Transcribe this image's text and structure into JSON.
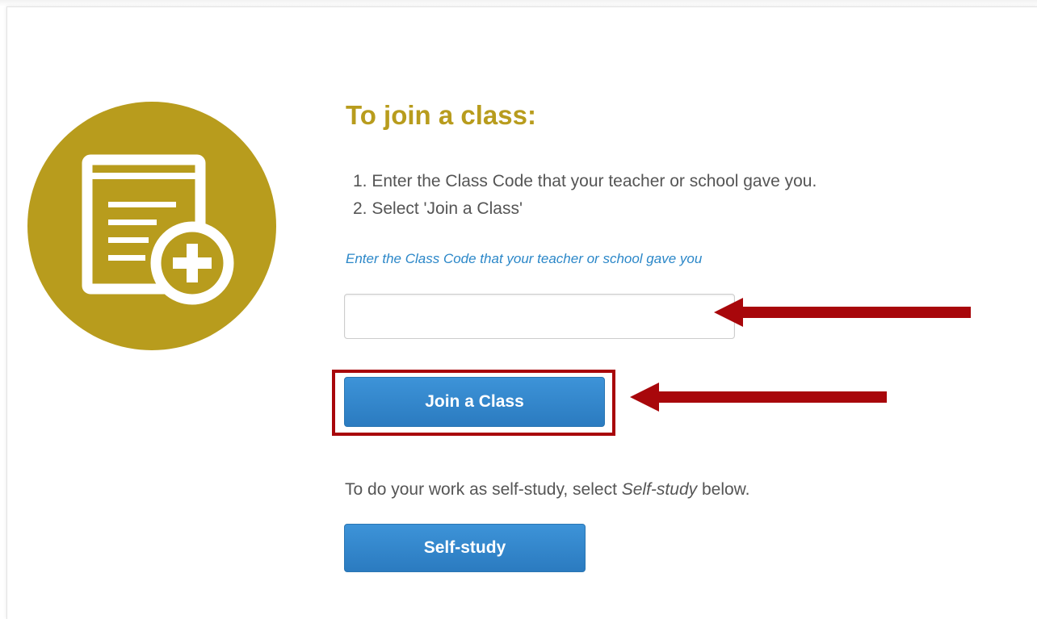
{
  "join_section": {
    "heading": "To join a class:",
    "steps": [
      "1. Enter the Class Code that your teacher or school gave you.",
      "2. Select 'Join a Class'"
    ],
    "code_label": "Enter the Class Code that your teacher or school gave you",
    "code_input": {
      "value": "",
      "placeholder": ""
    },
    "join_button_label": "Join a Class"
  },
  "self_study_section": {
    "text_before": "To do your work as self-study, select ",
    "text_emphasis": "Self-study",
    "text_after": " below.",
    "button_label": "Self-study"
  },
  "icons": {
    "main_icon": "book-add-icon",
    "annotation_arrows": "left-arrow-icon"
  },
  "colors": {
    "accent_gold": "#b89c1d",
    "button_blue": "#2b7bc0",
    "label_blue": "#2b87c8",
    "annotation_red": "#a8070b",
    "body_text": "#555555"
  }
}
